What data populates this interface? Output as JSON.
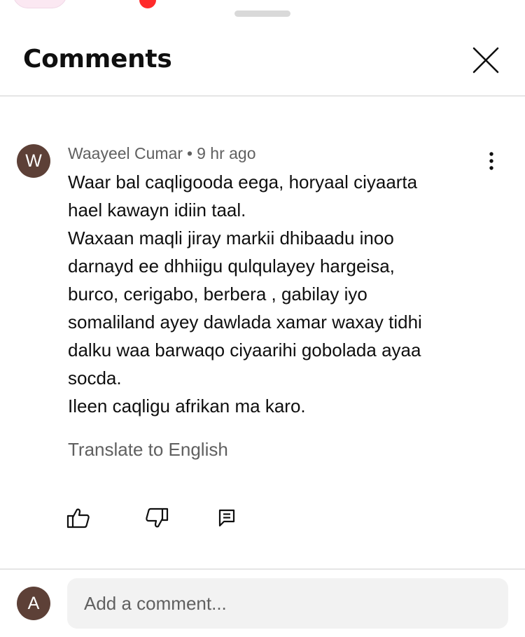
{
  "header": {
    "title": "Comments"
  },
  "comment": {
    "avatar_letter": "W",
    "author": "Waayeel Cumar",
    "separator": "•",
    "timestamp": "9 hr ago",
    "lines": [
      "Waar bal caqligooda eega, horyaal ciyaarta",
      "hael kawayn idiin taal.",
      "Waxaan maqli jiray markii dhibaadu inoo",
      "darnayd ee dhhiigu qulqulayey hargeisa,",
      "burco, cerigabo, berbera , gabilay iyo",
      "somaliland ayey dawlada xamar waxay tidhi",
      "dalku waa barwaqo ciyaarihi gobolada ayaa",
      "socda.",
      "Ileen caqligu afrikan ma karo."
    ],
    "translate_label": "Translate to English"
  },
  "composer": {
    "avatar_letter": "A",
    "placeholder": "Add a comment..."
  },
  "colors": {
    "avatar_bg": "#5d4037",
    "secondary_text": "#606060",
    "input_bg": "#f2f2f2"
  }
}
